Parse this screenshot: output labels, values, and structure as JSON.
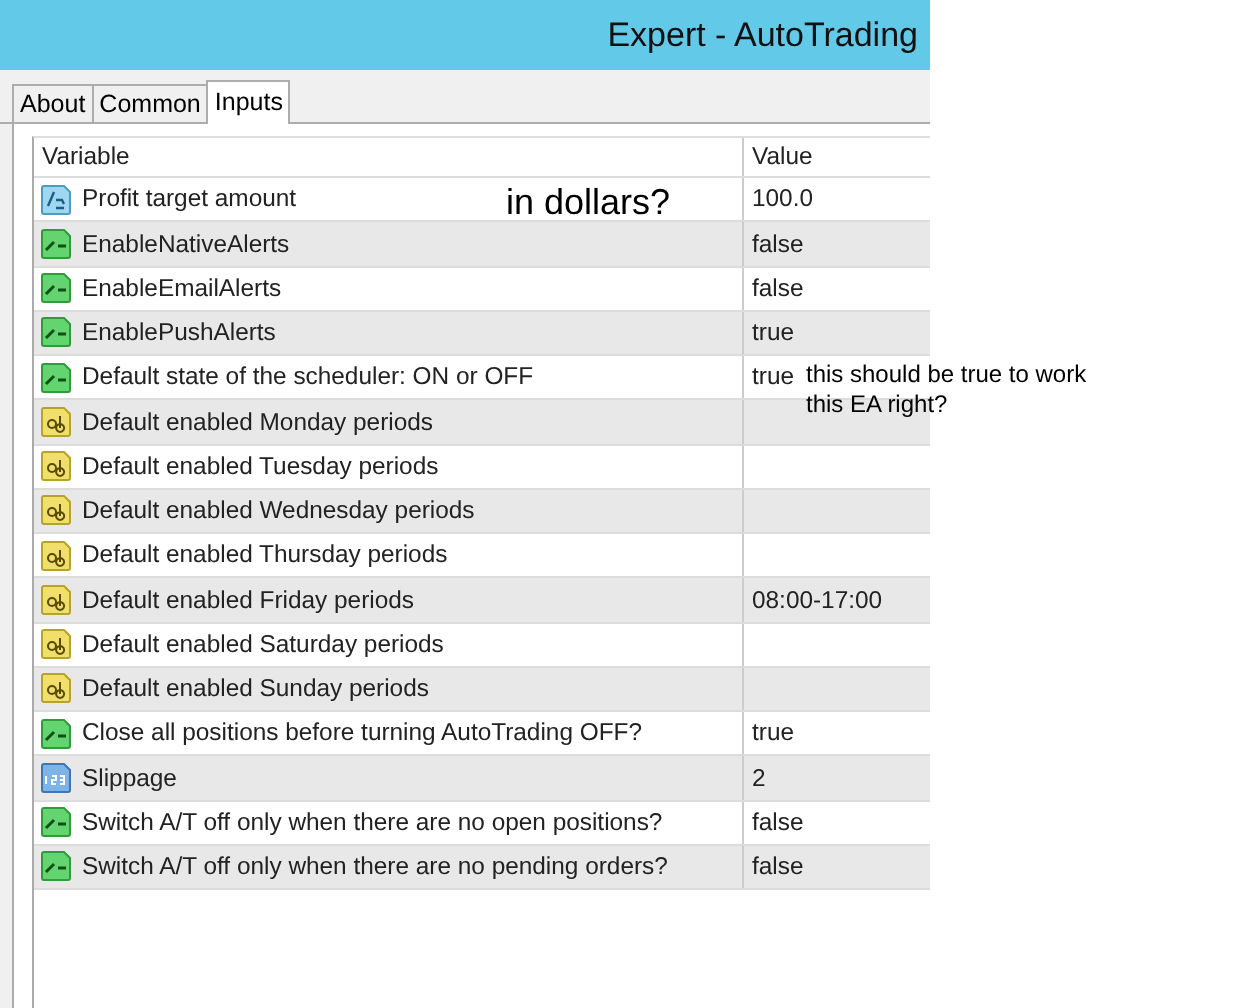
{
  "window": {
    "title": "Expert - AutoTrading"
  },
  "tabs": [
    {
      "label": "About",
      "selected": false
    },
    {
      "label": "Common",
      "selected": false
    },
    {
      "label": "Inputs",
      "selected": true
    }
  ],
  "table": {
    "columns": [
      "Variable",
      "Value"
    ],
    "rows": [
      {
        "kind": "double",
        "variable": "Profit target amount",
        "value": "100.0"
      },
      {
        "kind": "bool",
        "variable": "EnableNativeAlerts",
        "value": "false"
      },
      {
        "kind": "bool",
        "variable": "EnableEmailAlerts",
        "value": "false"
      },
      {
        "kind": "bool",
        "variable": "EnablePushAlerts",
        "value": "true"
      },
      {
        "kind": "bool",
        "variable": "Default state of the scheduler: ON or OFF",
        "value": "true"
      },
      {
        "kind": "string",
        "variable": "Default enabled Monday periods"
      },
      {
        "kind": "string",
        "variable": "Default enabled Tuesday periods"
      },
      {
        "kind": "string",
        "variable": "Default enabled Wednesday periods"
      },
      {
        "kind": "string",
        "variable": "Default enabled Thursday periods"
      },
      {
        "kind": "string",
        "variable": "Default enabled Friday periods",
        "value": "08:00-17:00"
      },
      {
        "kind": "string",
        "variable": "Default enabled Saturday periods"
      },
      {
        "kind": "string",
        "variable": "Default enabled Sunday periods"
      },
      {
        "kind": "bool",
        "variable": "Close all positions before turning AutoTrading OFF?",
        "value": "true"
      },
      {
        "kind": "int",
        "variable": "Slippage",
        "value": "2"
      },
      {
        "kind": "bool",
        "variable": "Switch A/T off only when there are no open positions?",
        "value": "false"
      },
      {
        "kind": "bool",
        "variable": "Switch A/T off only when there are no pending orders?",
        "value": "false"
      }
    ]
  },
  "annotations": [
    {
      "kind": "large",
      "text": "in dollars?"
    },
    {
      "kind": "small",
      "lines": [
        "this should be true to work",
        "this EA right?"
      ]
    }
  ]
}
